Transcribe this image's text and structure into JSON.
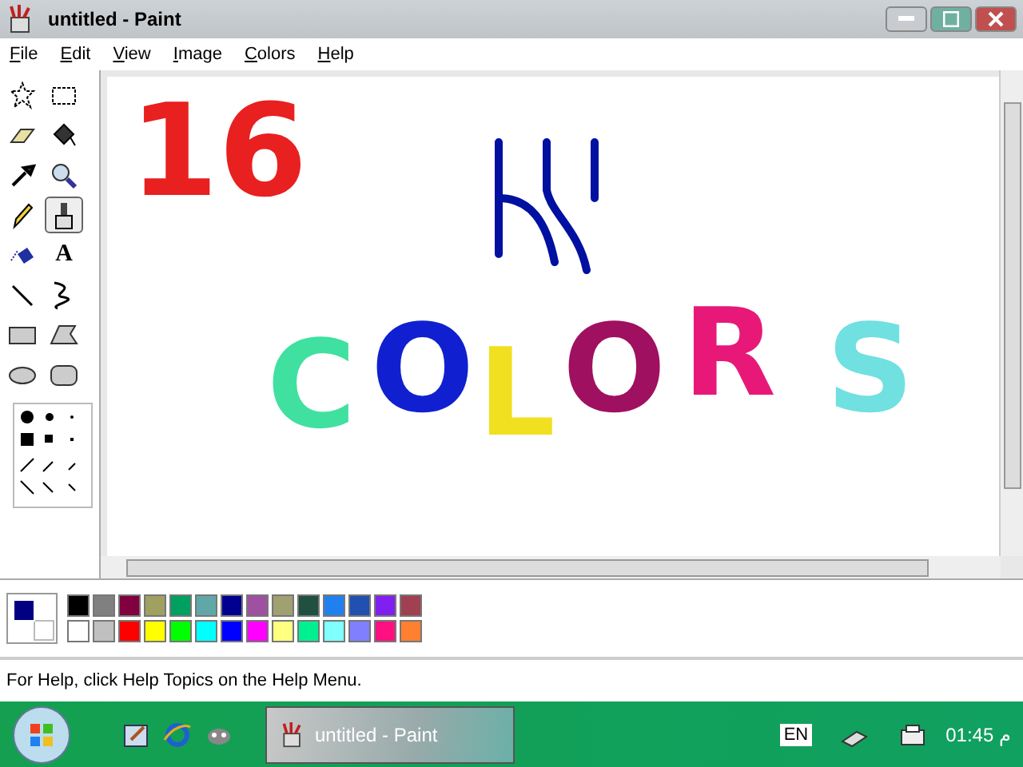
{
  "window": {
    "title": "untitled - Paint"
  },
  "menu": [
    {
      "label": "File"
    },
    {
      "label": "Edit"
    },
    {
      "label": "View"
    },
    {
      "label": "Image"
    },
    {
      "label": "Colors"
    },
    {
      "label": "Help"
    }
  ],
  "tools": [
    {
      "kind": "free-select",
      "selected": false
    },
    {
      "kind": "select",
      "selected": false
    },
    {
      "kind": "eraser",
      "selected": false
    },
    {
      "kind": "fill",
      "selected": false
    },
    {
      "kind": "picker",
      "selected": false
    },
    {
      "kind": "magnifier",
      "selected": false
    },
    {
      "kind": "pencil",
      "selected": false
    },
    {
      "kind": "brush",
      "selected": true
    },
    {
      "kind": "airbrush",
      "selected": false
    },
    {
      "kind": "text",
      "glyph": "A",
      "selected": false
    },
    {
      "kind": "line",
      "selected": false
    },
    {
      "kind": "curve",
      "selected": false
    },
    {
      "kind": "rect",
      "selected": false
    },
    {
      "kind": "polygon",
      "selected": false
    },
    {
      "kind": "ellipse",
      "selected": false
    },
    {
      "kind": "rounded-rect",
      "selected": false
    }
  ],
  "canvas": {
    "number": {
      "text": "16",
      "color": "#e82020"
    },
    "letters": [
      {
        "text": "C",
        "color": "#40e0a0"
      },
      {
        "text": "O",
        "color": "#1020d0"
      },
      {
        "text": "L",
        "color": "#f0e020"
      },
      {
        "text": "O",
        "color": "#a01060"
      },
      {
        "text": "R",
        "color": "#e81878"
      },
      {
        "text": "S",
        "color": "#70e0e0"
      }
    ]
  },
  "colors": {
    "foreground": {
      "color": "#000080"
    },
    "background": {
      "color": "#ffffff"
    },
    "palette": [
      {
        "color": "#000000"
      },
      {
        "color": "#808080"
      },
      {
        "color": "#800040"
      },
      {
        "color": "#a0a060"
      },
      {
        "color": "#00a060"
      },
      {
        "color": "#60a8a8"
      },
      {
        "color": "#000090"
      },
      {
        "color": "#a050a0"
      },
      {
        "color": "#a0a070"
      },
      {
        "color": "#205040"
      },
      {
        "color": "#2080f0"
      },
      {
        "color": "#2050b0"
      },
      {
        "color": "#8020f0"
      },
      {
        "color": "#a04050"
      },
      {
        "color": "#ffffff"
      },
      {
        "color": "#c0c0c0"
      },
      {
        "color": "#ff0000"
      },
      {
        "color": "#ffff00"
      },
      {
        "color": "#00ff00"
      },
      {
        "color": "#00ffff"
      },
      {
        "color": "#0000ff"
      },
      {
        "color": "#ff00ff"
      },
      {
        "color": "#ffff80"
      },
      {
        "color": "#00f090"
      },
      {
        "color": "#80ffff"
      },
      {
        "color": "#8080ff"
      },
      {
        "color": "#ff1080"
      },
      {
        "color": "#ff8030"
      }
    ]
  },
  "status_bar": {
    "text": "For Help, click Help Topics on the Help Menu."
  },
  "taskbar": {
    "tasks": [
      {
        "label": "untitled - Paint",
        "selected": true
      }
    ],
    "language": "EN",
    "clock": "01:45 م"
  }
}
